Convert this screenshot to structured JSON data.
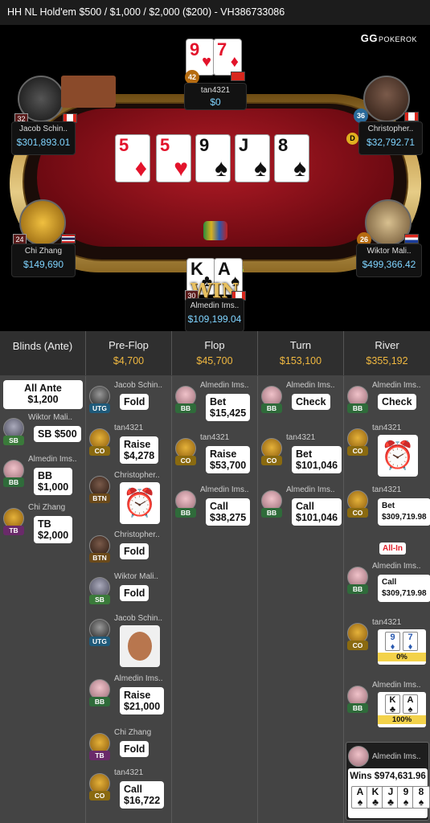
{
  "title": "HH NL Hold'em $500 / $1,000 / $2,000 ($200)   - VH386733086",
  "logo": {
    "main": "GG",
    "sub": "POKEROK"
  },
  "board": [
    {
      "rank": "5",
      "suit": "♦",
      "color": "#e3132b"
    },
    {
      "rank": "5",
      "suit": "♥",
      "color": "#e3132b"
    },
    {
      "rank": "9",
      "suit": "♠",
      "color": "#111111"
    },
    {
      "rank": "J",
      "suit": "♠",
      "color": "#111111"
    },
    {
      "rank": "8",
      "suit": "♠",
      "color": "#111111"
    }
  ],
  "pot": "$974,631.96",
  "win_text": "WIN",
  "players": {
    "top": {
      "name": "tan4321",
      "stack": "$0",
      "level": "42",
      "cards": [
        "9",
        "7"
      ]
    },
    "jacob": {
      "name": "Jacob Schin..",
      "stack": "$301,893.01",
      "level": "32"
    },
    "christopher": {
      "name": "Christopher..",
      "stack": "$32,792.71",
      "level": "36",
      "dealer": "D"
    },
    "chi": {
      "name": "Chi Zhang",
      "stack": "$149,690",
      "level": "24"
    },
    "wiktor": {
      "name": "Wiktor Mali..",
      "stack": "$499,366.42",
      "level": "26"
    },
    "almedin": {
      "name": "Almedin Ims..",
      "stack": "$109,199.04",
      "level": "30",
      "cards": [
        "K",
        "A"
      ]
    }
  },
  "columns": [
    {
      "title": "Blinds (Ante)",
      "value": ""
    },
    {
      "title": "Pre-Flop",
      "value": "$4,700"
    },
    {
      "title": "Flop",
      "value": "$45,700"
    },
    {
      "title": "Turn",
      "value": "$153,100"
    },
    {
      "title": "River",
      "value": "$355,192"
    }
  ],
  "blinds": {
    "all_ante": "All Ante",
    "all_ante_amt": "$1,200",
    "rows": [
      {
        "name": "Wiktor Mali..",
        "pos": "SB",
        "l1": "SB $500",
        "l2": ""
      },
      {
        "name": "Almedin Ims..",
        "pos": "BB",
        "l1": "BB",
        "l2": "$1,000"
      },
      {
        "name": "Chi Zhang",
        "pos": "TB",
        "l1": "TB",
        "l2": "$2,000"
      }
    ]
  },
  "preflop": [
    {
      "name": "Jacob Schin..",
      "pos": "UTG",
      "l1": "Fold",
      "l2": ""
    },
    {
      "name": "tan4321",
      "pos": "CO",
      "l1": "Raise",
      "l2": "$4,278"
    },
    {
      "name": "Christopher..",
      "pos": "BTN",
      "l1": "",
      "l2": ""
    },
    {
      "name": "Christopher..",
      "pos": "BTN",
      "l1": "Fold",
      "l2": ""
    },
    {
      "name": "Wiktor Mali..",
      "pos": "SB",
      "l1": "Fold",
      "l2": ""
    },
    {
      "name": "Jacob Schin..",
      "pos": "UTG",
      "l1": "",
      "l2": ""
    },
    {
      "name": "Almedin Ims..",
      "pos": "BB",
      "l1": "Raise",
      "l2": "$21,000"
    },
    {
      "name": "Chi Zhang",
      "pos": "TB",
      "l1": "Fold",
      "l2": ""
    },
    {
      "name": "tan4321",
      "pos": "CO",
      "l1": "Call",
      "l2": "$16,722"
    }
  ],
  "flop": [
    {
      "name": "Almedin Ims..",
      "pos": "BB",
      "l1": "Bet",
      "l2": "$15,425"
    },
    {
      "name": "tan4321",
      "pos": "CO",
      "l1": "Raise",
      "l2": "$53,700"
    },
    {
      "name": "Almedin Ims..",
      "pos": "BB",
      "l1": "Call",
      "l2": "$38,275"
    }
  ],
  "turn": [
    {
      "name": "Almedin Ims..",
      "pos": "BB",
      "l1": "Check",
      "l2": ""
    },
    {
      "name": "tan4321",
      "pos": "CO",
      "l1": "Bet",
      "l2": "$101,046"
    },
    {
      "name": "Almedin Ims..",
      "pos": "BB",
      "l1": "Call",
      "l2": "$101,046"
    }
  ],
  "river": [
    {
      "name": "Almedin Ims..",
      "pos": "BB",
      "l1": "Check",
      "l2": ""
    },
    {
      "name": "tan4321",
      "pos": "CO",
      "l1": "",
      "l2": ""
    },
    {
      "name": "tan4321",
      "pos": "CO",
      "l1": "Bet",
      "l2": "$309,719.98"
    },
    {
      "name": "Almedin Ims..",
      "pos": "BB",
      "l1": "Call",
      "l2": "$309,719.98"
    },
    {
      "name": "tan4321",
      "pos": "CO",
      "l1": "",
      "l2": "0%"
    },
    {
      "name": "Almedin Ims..",
      "pos": "BB",
      "l1": "",
      "l2": "100%"
    }
  ],
  "allin": "All-In",
  "winner": {
    "name": "Almedin Ims..",
    "label": "Wins $974,631.96",
    "cards": [
      "A",
      "K",
      "J",
      "9",
      "8"
    ]
  }
}
